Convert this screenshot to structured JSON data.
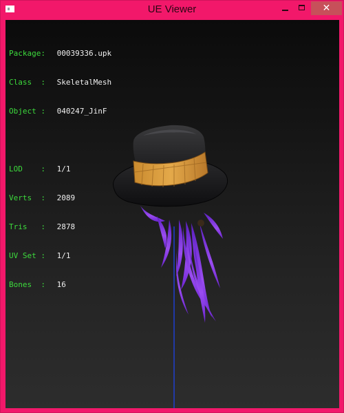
{
  "window": {
    "title": "UE Viewer",
    "minimize_glyph": "minimize",
    "maximize_glyph": "maximize",
    "close_glyph": "✕"
  },
  "colors": {
    "titlebar": "#f2186a",
    "close_button": "#c7505a",
    "label_green": "#3ddc3d",
    "value_white": "#f0f0f0",
    "bone_line": "#1f3fd0"
  },
  "icons": [
    "app-icon",
    "minimize-icon",
    "maximize-icon",
    "close-icon"
  ],
  "info": {
    "package_label": "Package:",
    "package_value": "00039336.upk",
    "class_label": "Class  :",
    "class_value": "SkeletalMesh",
    "object_label": "Object :",
    "object_value": "040247_JinF",
    "lod_label": "LOD    :",
    "lod_value": "1/1",
    "verts_label": "Verts  :",
    "verts_value": "2089",
    "tris_label": "Tris   :",
    "tris_value": "2878",
    "uvset_label": "UV Set :",
    "uvset_value": "1/1",
    "bones_label": "Bones  :",
    "bones_value": "16"
  }
}
